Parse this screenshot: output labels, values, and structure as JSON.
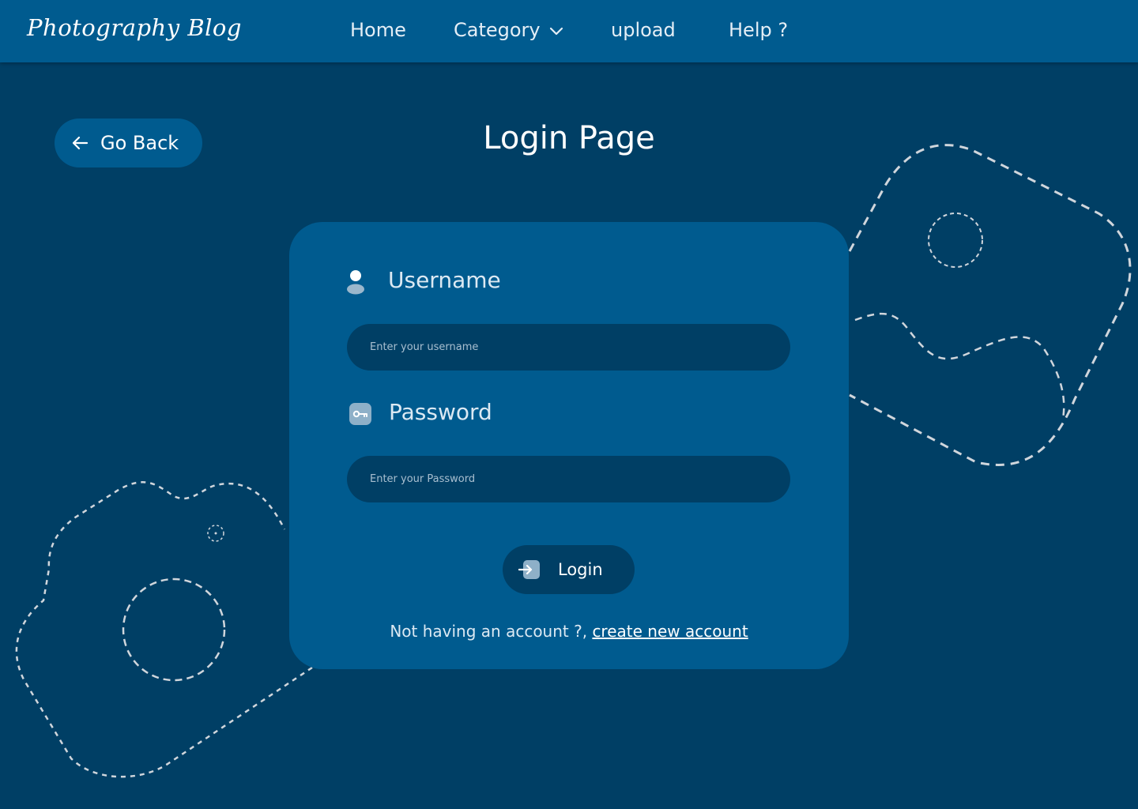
{
  "header": {
    "brand": "Photography Blog",
    "nav": {
      "home": "Home",
      "category": "Category",
      "upload": "upload",
      "help": "Help ?"
    }
  },
  "go_back": {
    "label": "Go Back"
  },
  "page_title": "Login Page",
  "form": {
    "username_label": "Username",
    "username_placeholder": "Enter your username",
    "password_label": "Password",
    "password_placeholder": "Enter your Password",
    "login_label": "Login",
    "signup_prompt": "Not having an account ?,",
    "signup_link": "create new account"
  },
  "icons": {
    "category": "chevron-down-icon",
    "go_back": "arrow-left-icon",
    "username": "user-icon",
    "password": "key-icon",
    "login": "login-arrow-icon",
    "decoration": [
      "image-outline-icon",
      "camera-outline-icon"
    ]
  },
  "colors": {
    "background": "#003f65",
    "header": "#005b8f",
    "card": "#005b8f",
    "input": "#003f65",
    "text": "#ffffff",
    "decoration_stroke": "#d0d6dc"
  }
}
